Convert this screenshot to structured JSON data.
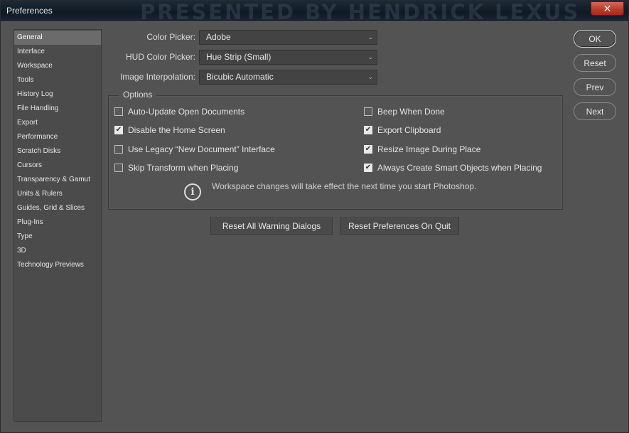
{
  "window": {
    "title": "Preferences",
    "watermark": "PRESENTED BY HENDRICK LEXUS",
    "close_glyph": "✕"
  },
  "sidebar": {
    "items": [
      {
        "label": "General",
        "selected": true
      },
      {
        "label": "Interface"
      },
      {
        "label": "Workspace"
      },
      {
        "label": "Tools"
      },
      {
        "label": "History Log"
      },
      {
        "label": "File Handling"
      },
      {
        "label": "Export"
      },
      {
        "label": "Performance"
      },
      {
        "label": "Scratch Disks"
      },
      {
        "label": "Cursors"
      },
      {
        "label": "Transparency & Gamut"
      },
      {
        "label": "Units & Rulers"
      },
      {
        "label": "Guides, Grid & Slices"
      },
      {
        "label": "Plug-Ins"
      },
      {
        "label": "Type"
      },
      {
        "label": "3D"
      },
      {
        "label": "Technology Previews"
      }
    ]
  },
  "form": {
    "color_picker": {
      "label": "Color Picker:",
      "value": "Adobe"
    },
    "hud_color_picker": {
      "label": "HUD Color Picker:",
      "value": "Hue Strip (Small)"
    },
    "image_interpolation": {
      "label": "Image Interpolation:",
      "value": "Bicubic Automatic"
    }
  },
  "options": {
    "legend": "Options",
    "left": [
      {
        "label": "Auto-Update Open Documents",
        "checked": false
      },
      {
        "label": "Disable the Home Screen",
        "checked": true
      },
      {
        "label": "Use Legacy “New Document” Interface",
        "checked": false
      },
      {
        "label": "Skip Transform when Placing",
        "checked": false
      }
    ],
    "right": [
      {
        "label": "Beep When Done",
        "checked": false
      },
      {
        "label": "Export Clipboard",
        "checked": true
      },
      {
        "label": "Resize Image During Place",
        "checked": true
      },
      {
        "label": "Always Create Smart Objects when Placing",
        "checked": true
      }
    ],
    "info_text": "Workspace changes will take effect the next time you start Photoshop."
  },
  "buttons": {
    "reset_warnings": "Reset All Warning Dialogs",
    "reset_prefs": "Reset Preferences On Quit",
    "ok": "OK",
    "reset": "Reset",
    "prev": "Prev",
    "next": "Next"
  },
  "icons": {
    "check": "✔",
    "chevron": "⌄",
    "info": "i"
  },
  "colors": {
    "background": "#535353",
    "sidebar": "#4b4b4b",
    "selected": "#6b6b6b",
    "titlebar": "#0f1a24",
    "close": "#c0392b"
  }
}
